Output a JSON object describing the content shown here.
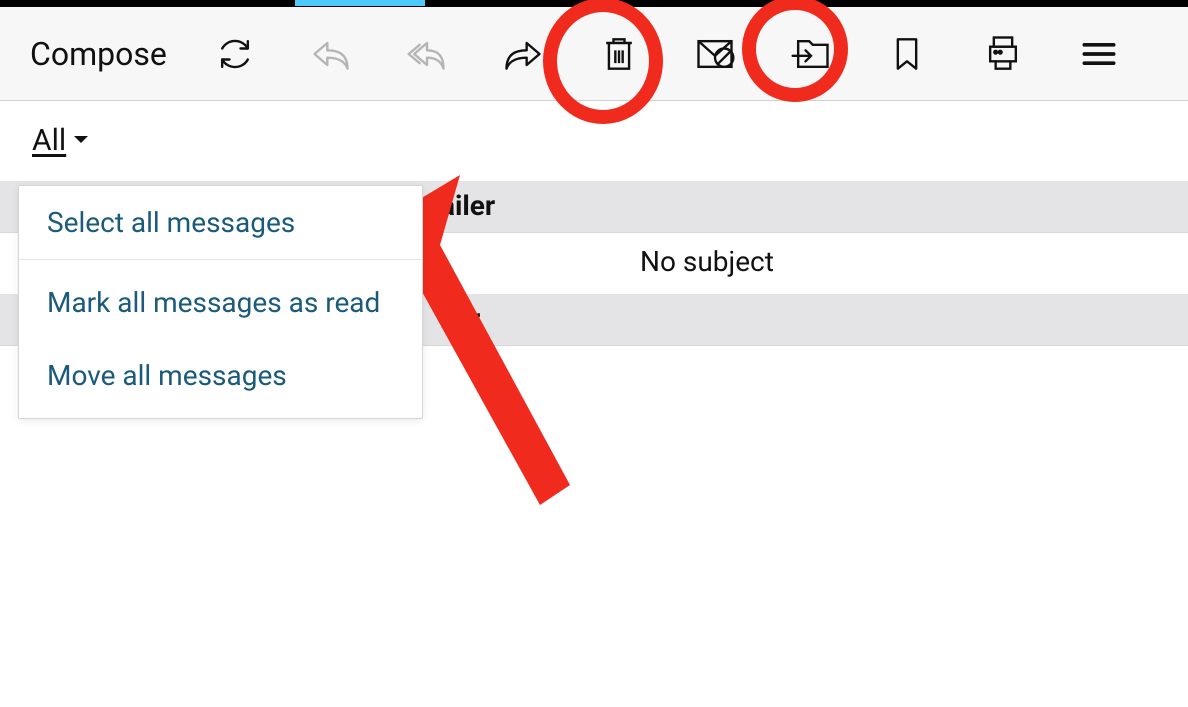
{
  "toolbar": {
    "compose_label": "Compose"
  },
  "filter": {
    "label": "All"
  },
  "dropdown": {
    "select_all": "Select all messages",
    "mark_read": "Mark all messages as read",
    "move_all": "Move all messages"
  },
  "messages": {
    "header1_suffix": "ailer",
    "subject1": "No subject",
    "header2_suffix": "iler"
  }
}
